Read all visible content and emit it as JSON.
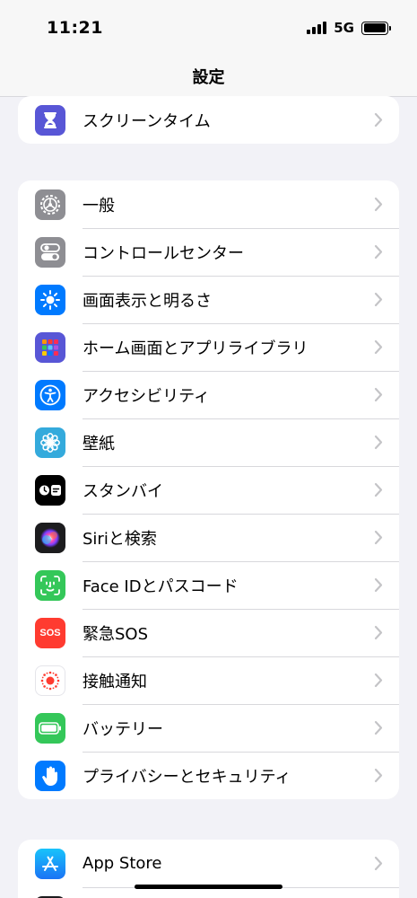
{
  "status": {
    "time": "11:21",
    "network": "5G"
  },
  "nav": {
    "title": "設定"
  },
  "groups": [
    {
      "items": [
        {
          "label": "スクリーンタイム",
          "icon": "hourglass-icon",
          "color": "#5856d6"
        }
      ]
    },
    {
      "items": [
        {
          "label": "一般",
          "icon": "gear-icon",
          "color": "#8e8e93"
        },
        {
          "label": "コントロールセンター",
          "icon": "toggles-icon",
          "color": "#8e8e93"
        },
        {
          "label": "画面表示と明るさ",
          "icon": "sun-icon",
          "color": "#007aff"
        },
        {
          "label": "ホーム画面とアプリライブラリ",
          "icon": "app-grid-icon",
          "color": "#5856d6"
        },
        {
          "label": "アクセシビリティ",
          "icon": "accessibility-icon",
          "color": "#007aff"
        },
        {
          "label": "壁紙",
          "icon": "flower-icon",
          "color": "#34aadc"
        },
        {
          "label": "スタンバイ",
          "icon": "standby-icon",
          "color": "#000000"
        },
        {
          "label": "Siriと検索",
          "icon": "siri-icon",
          "color": "#1c1c1e"
        },
        {
          "label": "Face IDとパスコード",
          "icon": "face-id-icon",
          "color": "#34c759"
        },
        {
          "label": "緊急SOS",
          "icon": "sos-icon",
          "color": "#ff3b30",
          "icon_text": "SOS"
        },
        {
          "label": "接触通知",
          "icon": "exposure-notification-icon",
          "color": "#ffffff"
        },
        {
          "label": "バッテリー",
          "icon": "battery-icon",
          "color": "#34c759"
        },
        {
          "label": "プライバシーとセキュリティ",
          "icon": "hand-icon",
          "color": "#007aff"
        }
      ]
    },
    {
      "items": [
        {
          "label": "App Store",
          "icon": "app-store-icon",
          "color": "#1c8ef9"
        }
      ]
    }
  ]
}
